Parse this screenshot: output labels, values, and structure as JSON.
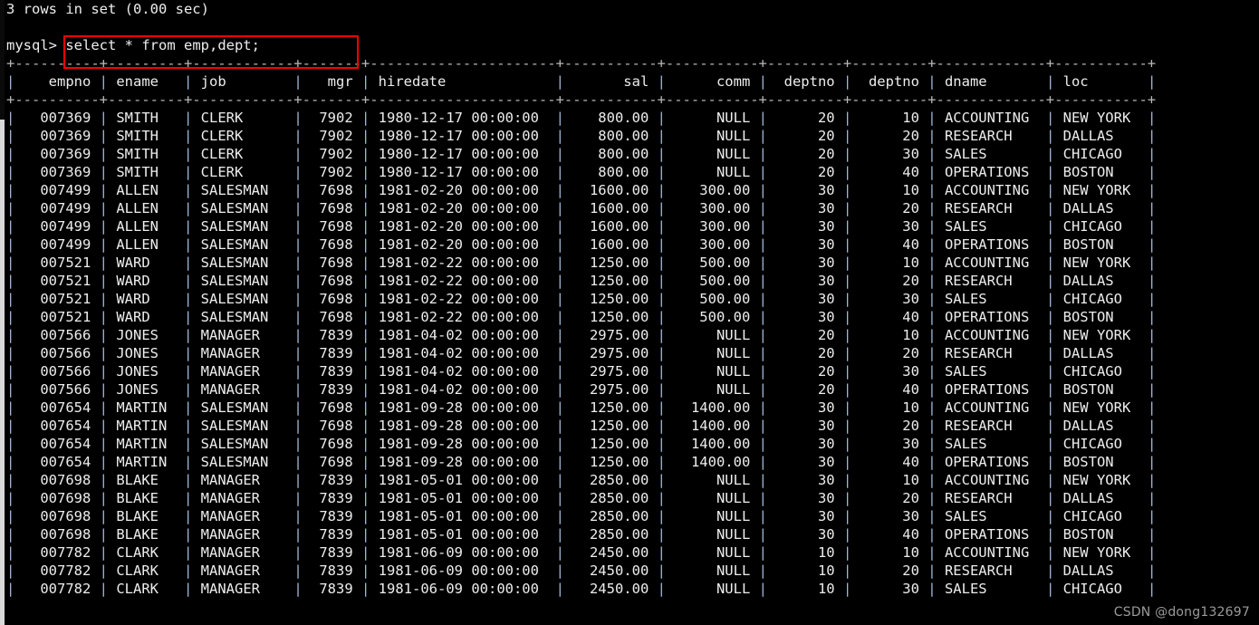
{
  "terminal": {
    "result_line": "3 rows in set (0.00 sec)",
    "prompt": "mysql>",
    "command": "select * from emp,dept;",
    "watermark": "CSDN @dong132697",
    "background_color": "#000000",
    "text_color": "#e8e8e8",
    "pipe_color": "#9fb6d4",
    "highlight_color": "#fe0000"
  },
  "table": {
    "columns": [
      {
        "name": "empno",
        "width": 8,
        "align": "right"
      },
      {
        "name": "ename",
        "width": 7,
        "align": "left"
      },
      {
        "name": "job",
        "width": 10,
        "align": "left"
      },
      {
        "name": "mgr",
        "width": 5,
        "align": "right"
      },
      {
        "name": "hiredate",
        "width": 20,
        "align": "left"
      },
      {
        "name": "sal",
        "width": 9,
        "align": "right"
      },
      {
        "name": "comm",
        "width": 9,
        "align": "right"
      },
      {
        "name": "deptno",
        "width": 7,
        "align": "right"
      },
      {
        "name": "deptno",
        "width": 7,
        "align": "right"
      },
      {
        "name": "dname",
        "width": 11,
        "align": "left"
      },
      {
        "name": "loc",
        "width": 9,
        "align": "left"
      }
    ],
    "rows": [
      [
        "007369",
        "SMITH",
        "CLERK",
        "7902",
        "1980-12-17 00:00:00",
        "800.00",
        "NULL",
        "20",
        "10",
        "ACCOUNTING",
        "NEW YORK"
      ],
      [
        "007369",
        "SMITH",
        "CLERK",
        "7902",
        "1980-12-17 00:00:00",
        "800.00",
        "NULL",
        "20",
        "20",
        "RESEARCH",
        "DALLAS"
      ],
      [
        "007369",
        "SMITH",
        "CLERK",
        "7902",
        "1980-12-17 00:00:00",
        "800.00",
        "NULL",
        "20",
        "30",
        "SALES",
        "CHICAGO"
      ],
      [
        "007369",
        "SMITH",
        "CLERK",
        "7902",
        "1980-12-17 00:00:00",
        "800.00",
        "NULL",
        "20",
        "40",
        "OPERATIONS",
        "BOSTON"
      ],
      [
        "007499",
        "ALLEN",
        "SALESMAN",
        "7698",
        "1981-02-20 00:00:00",
        "1600.00",
        "300.00",
        "30",
        "10",
        "ACCOUNTING",
        "NEW YORK"
      ],
      [
        "007499",
        "ALLEN",
        "SALESMAN",
        "7698",
        "1981-02-20 00:00:00",
        "1600.00",
        "300.00",
        "30",
        "20",
        "RESEARCH",
        "DALLAS"
      ],
      [
        "007499",
        "ALLEN",
        "SALESMAN",
        "7698",
        "1981-02-20 00:00:00",
        "1600.00",
        "300.00",
        "30",
        "30",
        "SALES",
        "CHICAGO"
      ],
      [
        "007499",
        "ALLEN",
        "SALESMAN",
        "7698",
        "1981-02-20 00:00:00",
        "1600.00",
        "300.00",
        "30",
        "40",
        "OPERATIONS",
        "BOSTON"
      ],
      [
        "007521",
        "WARD",
        "SALESMAN",
        "7698",
        "1981-02-22 00:00:00",
        "1250.00",
        "500.00",
        "30",
        "10",
        "ACCOUNTING",
        "NEW YORK"
      ],
      [
        "007521",
        "WARD",
        "SALESMAN",
        "7698",
        "1981-02-22 00:00:00",
        "1250.00",
        "500.00",
        "30",
        "20",
        "RESEARCH",
        "DALLAS"
      ],
      [
        "007521",
        "WARD",
        "SALESMAN",
        "7698",
        "1981-02-22 00:00:00",
        "1250.00",
        "500.00",
        "30",
        "30",
        "SALES",
        "CHICAGO"
      ],
      [
        "007521",
        "WARD",
        "SALESMAN",
        "7698",
        "1981-02-22 00:00:00",
        "1250.00",
        "500.00",
        "30",
        "40",
        "OPERATIONS",
        "BOSTON"
      ],
      [
        "007566",
        "JONES",
        "MANAGER",
        "7839",
        "1981-04-02 00:00:00",
        "2975.00",
        "NULL",
        "20",
        "10",
        "ACCOUNTING",
        "NEW YORK"
      ],
      [
        "007566",
        "JONES",
        "MANAGER",
        "7839",
        "1981-04-02 00:00:00",
        "2975.00",
        "NULL",
        "20",
        "20",
        "RESEARCH",
        "DALLAS"
      ],
      [
        "007566",
        "JONES",
        "MANAGER",
        "7839",
        "1981-04-02 00:00:00",
        "2975.00",
        "NULL",
        "20",
        "30",
        "SALES",
        "CHICAGO"
      ],
      [
        "007566",
        "JONES",
        "MANAGER",
        "7839",
        "1981-04-02 00:00:00",
        "2975.00",
        "NULL",
        "20",
        "40",
        "OPERATIONS",
        "BOSTON"
      ],
      [
        "007654",
        "MARTIN",
        "SALESMAN",
        "7698",
        "1981-09-28 00:00:00",
        "1250.00",
        "1400.00",
        "30",
        "10",
        "ACCOUNTING",
        "NEW YORK"
      ],
      [
        "007654",
        "MARTIN",
        "SALESMAN",
        "7698",
        "1981-09-28 00:00:00",
        "1250.00",
        "1400.00",
        "30",
        "20",
        "RESEARCH",
        "DALLAS"
      ],
      [
        "007654",
        "MARTIN",
        "SALESMAN",
        "7698",
        "1981-09-28 00:00:00",
        "1250.00",
        "1400.00",
        "30",
        "30",
        "SALES",
        "CHICAGO"
      ],
      [
        "007654",
        "MARTIN",
        "SALESMAN",
        "7698",
        "1981-09-28 00:00:00",
        "1250.00",
        "1400.00",
        "30",
        "40",
        "OPERATIONS",
        "BOSTON"
      ],
      [
        "007698",
        "BLAKE",
        "MANAGER",
        "7839",
        "1981-05-01 00:00:00",
        "2850.00",
        "NULL",
        "30",
        "10",
        "ACCOUNTING",
        "NEW YORK"
      ],
      [
        "007698",
        "BLAKE",
        "MANAGER",
        "7839",
        "1981-05-01 00:00:00",
        "2850.00",
        "NULL",
        "30",
        "20",
        "RESEARCH",
        "DALLAS"
      ],
      [
        "007698",
        "BLAKE",
        "MANAGER",
        "7839",
        "1981-05-01 00:00:00",
        "2850.00",
        "NULL",
        "30",
        "30",
        "SALES",
        "CHICAGO"
      ],
      [
        "007698",
        "BLAKE",
        "MANAGER",
        "7839",
        "1981-05-01 00:00:00",
        "2850.00",
        "NULL",
        "30",
        "40",
        "OPERATIONS",
        "BOSTON"
      ],
      [
        "007782",
        "CLARK",
        "MANAGER",
        "7839",
        "1981-06-09 00:00:00",
        "2450.00",
        "NULL",
        "10",
        "10",
        "ACCOUNTING",
        "NEW YORK"
      ],
      [
        "007782",
        "CLARK",
        "MANAGER",
        "7839",
        "1981-06-09 00:00:00",
        "2450.00",
        "NULL",
        "10",
        "20",
        "RESEARCH",
        "DALLAS"
      ],
      [
        "007782",
        "CLARK",
        "MANAGER",
        "7839",
        "1981-06-09 00:00:00",
        "2450.00",
        "NULL",
        "10",
        "30",
        "SALES",
        "CHICAGO"
      ]
    ]
  }
}
